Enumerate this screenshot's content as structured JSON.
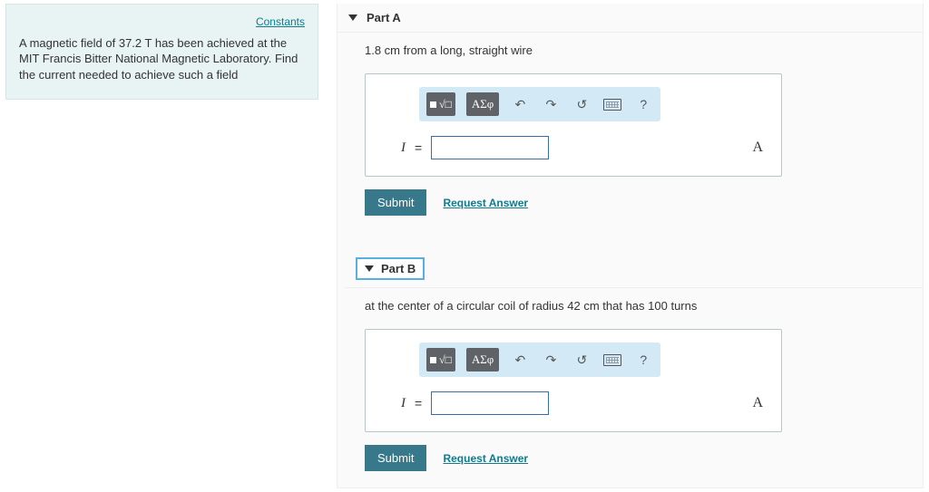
{
  "left": {
    "constants_link": "Constants",
    "problem": "A magnetic field of 37.2 T has been achieved at the MIT Francis Bitter National Magnetic Laboratory. Find the current needed to achieve such a field"
  },
  "partA": {
    "title": "Part A",
    "prompt": "1.8 cm from a long, straight wire",
    "toolbar": {
      "greek": "ΑΣφ",
      "undo": "↶",
      "redo": "↷",
      "reset": "↺",
      "help": "?"
    },
    "variable": "I",
    "equals": "=",
    "unit": "A",
    "submit": "Submit",
    "request": "Request Answer"
  },
  "partB": {
    "title": "Part B",
    "prompt": "at the center of a circular coil of radius 42 cm that has 100 turns",
    "toolbar": {
      "greek": "ΑΣφ",
      "undo": "↶",
      "redo": "↷",
      "reset": "↺",
      "help": "?"
    },
    "variable": "I",
    "equals": "=",
    "unit": "A",
    "submit": "Submit",
    "request": "Request Answer"
  }
}
